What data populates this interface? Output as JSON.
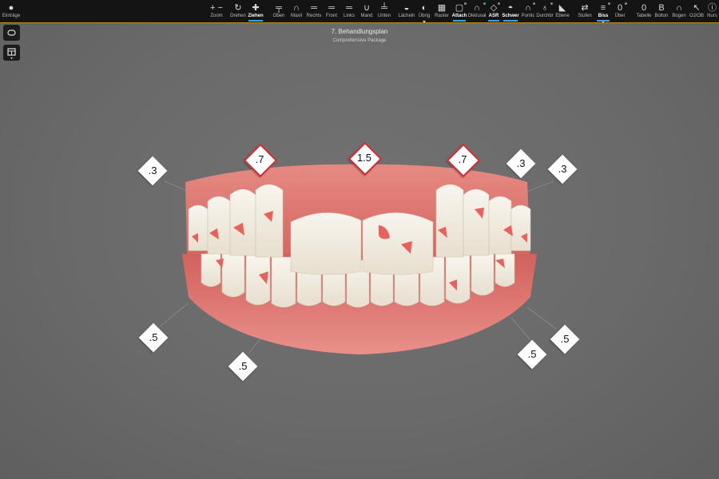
{
  "toolbar": {
    "items": [
      {
        "label": "Einträge",
        "icon": "user-icon"
      },
      {
        "label": "Zoom",
        "icon": "zoom-icon"
      },
      {
        "label": "Drehen",
        "icon": "rotate-icon"
      },
      {
        "label": "Ziehen",
        "icon": "move-icon",
        "active": true
      },
      {
        "label": "Oben",
        "icon": "view-top-icon"
      },
      {
        "label": "Maxil",
        "icon": "maxilla-icon"
      },
      {
        "label": "Rechts",
        "icon": "view-right-icon"
      },
      {
        "label": "Front",
        "icon": "view-front-icon"
      },
      {
        "label": "Links",
        "icon": "view-left-icon"
      },
      {
        "label": "Mand",
        "icon": "mandible-icon"
      },
      {
        "label": "Unten",
        "icon": "view-bottom-icon"
      },
      {
        "label": "Lächeln",
        "icon": "smile-icon"
      },
      {
        "label": "Übrig",
        "icon": "remaining-icon"
      },
      {
        "label": "Raster",
        "icon": "grid-icon"
      },
      {
        "label": "Attach",
        "icon": "attachment-icon",
        "active": true
      },
      {
        "label": "Okklusal",
        "icon": "occlusal-icon"
      },
      {
        "label": "ASR",
        "icon": "asr-icon",
        "active": true
      },
      {
        "label": "Schwer",
        "icon": "gauge-icon",
        "active": true
      },
      {
        "label": "Pontic",
        "icon": "pontic-icon"
      },
      {
        "label": "Durchbr",
        "icon": "eruption-icon"
      },
      {
        "label": "Ebene",
        "icon": "plane-icon"
      },
      {
        "label": "Stufen",
        "icon": "stages-icon"
      },
      {
        "label": "Biss",
        "icon": "bite-icon",
        "active": true
      },
      {
        "label": "Über",
        "icon": "overlay-icon"
      },
      {
        "label": "Tabelle",
        "icon": "table-icon"
      },
      {
        "label": "Bolton",
        "icon": "bolton-icon"
      },
      {
        "label": "Bogen",
        "icon": "arch-icon"
      },
      {
        "label": "OJ/OB",
        "icon": "overjet-icon"
      },
      {
        "label": "Nurs",
        "icon": "info-icon"
      }
    ]
  },
  "sidebar": {
    "items": [
      {
        "icon": "jaw-toggle-icon"
      },
      {
        "icon": "layout-icon"
      }
    ]
  },
  "header": {
    "title": "7. Behandlungsplan",
    "subtitle": "Comprehensive Package"
  },
  "model": {
    "description_icon": "dental-arch-3d-model",
    "colors": {
      "gum": "#e07a74",
      "tooth": "#f2ede2",
      "attachment": "#e8615c"
    }
  },
  "labels": [
    {
      "text": ".3",
      "highlight": false
    },
    {
      "text": ".7",
      "highlight": true
    },
    {
      "text": "1.5",
      "highlight": true
    },
    {
      "text": ".7",
      "highlight": true
    },
    {
      "text": ".3",
      "highlight": false
    },
    {
      "text": ".3",
      "highlight": false
    },
    {
      "text": ".5",
      "highlight": false
    },
    {
      "text": ".5",
      "highlight": false
    },
    {
      "text": ".5",
      "highlight": false
    },
    {
      "text": ".5",
      "highlight": false
    }
  ],
  "accent_colors": {
    "active_underline": "#3aa0ff",
    "toolbar_border": "#c98a12",
    "label_border": "#d6262b"
  }
}
